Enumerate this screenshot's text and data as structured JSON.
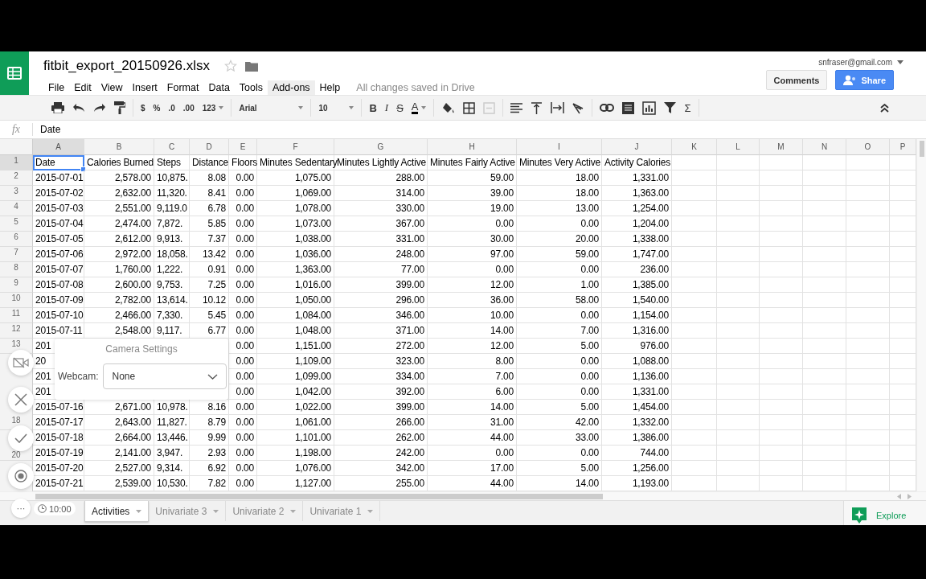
{
  "document": {
    "title": "fitbit_export_20150926.xlsx",
    "save_status": "All changes saved in Drive"
  },
  "menu": [
    {
      "label": "File",
      "highlighted": false
    },
    {
      "label": "Edit",
      "highlighted": false
    },
    {
      "label": "View",
      "highlighted": false
    },
    {
      "label": "Insert",
      "highlighted": false
    },
    {
      "label": "Format",
      "highlighted": false
    },
    {
      "label": "Data",
      "highlighted": false
    },
    {
      "label": "Tools",
      "highlighted": false
    },
    {
      "label": "Add-ons",
      "highlighted": true
    },
    {
      "label": "Help",
      "highlighted": false
    }
  ],
  "account": {
    "email": "snfraser@gmail.com"
  },
  "buttons": {
    "comments": "Comments",
    "share": "Share"
  },
  "toolbar": {
    "currency": "$",
    "percent": "%",
    "decimal_less": ".0",
    "decimal_more": ".00",
    "number_format": "123",
    "font": "Arial",
    "font_size": "10",
    "bold": "B",
    "italic": "I",
    "strike": "S",
    "text_color": "A",
    "functions": "Σ"
  },
  "formula_bar": {
    "label": "fx",
    "value": "Date"
  },
  "columns": [
    {
      "letter": "A",
      "selected": true
    },
    {
      "letter": "B",
      "selected": false
    },
    {
      "letter": "C",
      "selected": false
    },
    {
      "letter": "D",
      "selected": false
    },
    {
      "letter": "E",
      "selected": false
    },
    {
      "letter": "F",
      "selected": false
    },
    {
      "letter": "G",
      "selected": false
    },
    {
      "letter": "H",
      "selected": false
    },
    {
      "letter": "I",
      "selected": false
    },
    {
      "letter": "J",
      "selected": false
    },
    {
      "letter": "K",
      "selected": false
    },
    {
      "letter": "L",
      "selected": false
    },
    {
      "letter": "M",
      "selected": false
    },
    {
      "letter": "N",
      "selected": false
    },
    {
      "letter": "O",
      "selected": false
    },
    {
      "letter": "P",
      "selected": false
    }
  ],
  "rows": [
    {
      "number": "1",
      "selected": true,
      "cells": [
        "Date",
        "Calories Burned",
        "Steps",
        "Distance",
        "Floors",
        "Minutes Sedentary",
        "Minutes Lightly Active",
        "Minutes Fairly Active",
        "Minutes Very Active",
        "Activity Calories"
      ]
    },
    {
      "number": "2",
      "selected": false,
      "cells": [
        "2015-07-01",
        "2,578.00",
        "10,875.",
        "8.08",
        "0.00",
        "1,075.00",
        "288.00",
        "59.00",
        "18.00",
        "1,331.00"
      ]
    },
    {
      "number": "3",
      "selected": false,
      "cells": [
        "2015-07-02",
        "2,632.00",
        "11,320.",
        "8.41",
        "0.00",
        "1,069.00",
        "314.00",
        "39.00",
        "18.00",
        "1,363.00"
      ]
    },
    {
      "number": "4",
      "selected": false,
      "cells": [
        "2015-07-03",
        "2,551.00",
        "9,119.0",
        "6.78",
        "0.00",
        "1,078.00",
        "330.00",
        "19.00",
        "13.00",
        "1,254.00"
      ]
    },
    {
      "number": "5",
      "selected": false,
      "cells": [
        "2015-07-04",
        "2,474.00",
        "7,872.",
        "5.85",
        "0.00",
        "1,073.00",
        "367.00",
        "0.00",
        "0.00",
        "1,204.00"
      ]
    },
    {
      "number": "6",
      "selected": false,
      "cells": [
        "2015-07-05",
        "2,612.00",
        "9,913.",
        "7.37",
        "0.00",
        "1,038.00",
        "331.00",
        "30.00",
        "20.00",
        "1,338.00"
      ]
    },
    {
      "number": "7",
      "selected": false,
      "cells": [
        "2015-07-06",
        "2,972.00",
        "18,058.",
        "13.42",
        "0.00",
        "1,036.00",
        "248.00",
        "97.00",
        "59.00",
        "1,747.00"
      ]
    },
    {
      "number": "8",
      "selected": false,
      "cells": [
        "2015-07-07",
        "1,760.00",
        "1,222.",
        "0.91",
        "0.00",
        "1,363.00",
        "77.00",
        "0.00",
        "0.00",
        "236.00"
      ]
    },
    {
      "number": "9",
      "selected": false,
      "cells": [
        "2015-07-08",
        "2,600.00",
        "9,753.",
        "7.25",
        "0.00",
        "1,016.00",
        "399.00",
        "12.00",
        "1.00",
        "1,385.00"
      ]
    },
    {
      "number": "10",
      "selected": false,
      "cells": [
        "2015-07-09",
        "2,782.00",
        "13,614.",
        "10.12",
        "0.00",
        "1,050.00",
        "296.00",
        "36.00",
        "58.00",
        "1,540.00"
      ]
    },
    {
      "number": "11",
      "selected": false,
      "cells": [
        "2015-07-10",
        "2,466.00",
        "7,330.",
        "5.45",
        "0.00",
        "1,084.00",
        "346.00",
        "10.00",
        "0.00",
        "1,154.00"
      ]
    },
    {
      "number": "12",
      "selected": false,
      "cells": [
        "2015-07-11",
        "2,548.00",
        "9,117.",
        "6.77",
        "0.00",
        "1,048.00",
        "371.00",
        "14.00",
        "7.00",
        "1,316.00"
      ]
    },
    {
      "number": "13",
      "selected": false,
      "cells": [
        "201",
        null,
        null,
        null,
        "0.00",
        "1,151.00",
        "272.00",
        "12.00",
        "5.00",
        "976.00"
      ]
    },
    {
      "selected": false,
      "cells": [
        "20",
        null,
        null,
        null,
        "0.00",
        "1,109.00",
        "323.00",
        "8.00",
        "0.00",
        "1,088.00"
      ]
    },
    {
      "selected": false,
      "cells": [
        "201",
        null,
        null,
        null,
        "0.00",
        "1,099.00",
        "334.00",
        "7.00",
        "0.00",
        "1,136.00"
      ]
    },
    {
      "selected": false,
      "cells": [
        "201",
        null,
        null,
        null,
        "0.00",
        "1,042.00",
        "392.00",
        "6.00",
        "0.00",
        "1,331.00"
      ]
    },
    {
      "selected": false,
      "cells": [
        "2015-07-16",
        "2,671.00",
        "10,978.",
        "8.16",
        "0.00",
        "1,022.00",
        "399.00",
        "14.00",
        "5.00",
        "1,454.00"
      ]
    },
    {
      "number": "18",
      "selected": false,
      "cells": [
        "2015-07-17",
        "2,643.00",
        "11,827.",
        "8.79",
        "0.00",
        "1,061.00",
        "266.00",
        "31.00",
        "42.00",
        "1,332.00"
      ]
    },
    {
      "selected": false,
      "cells": [
        "2015-07-18",
        "2,664.00",
        "13,446.",
        "9.99",
        "0.00",
        "1,101.00",
        "262.00",
        "44.00",
        "33.00",
        "1,386.00"
      ]
    },
    {
      "number": "20",
      "selected": false,
      "cells": [
        "2015-07-19",
        "2,141.00",
        "3,947.",
        "2.93",
        "0.00",
        "1,198.00",
        "242.00",
        "0.00",
        "0.00",
        "744.00"
      ]
    },
    {
      "selected": false,
      "cells": [
        "2015-07-20",
        "2,527.00",
        "9,314.",
        "6.92",
        "0.00",
        "1,076.00",
        "342.00",
        "17.00",
        "5.00",
        "1,256.00"
      ]
    },
    {
      "selected": false,
      "cells": [
        "2015-07-21",
        "2,539.00",
        "10,530.",
        "7.82",
        "0.00",
        "1,127.00",
        "255.00",
        "44.00",
        "14.00",
        "1,193.00"
      ]
    }
  ],
  "sheet_tabs": [
    {
      "label": "Activities",
      "selected": true
    },
    {
      "label": "Univariate 3",
      "selected": false
    },
    {
      "label": "Univariate 2",
      "selected": false
    },
    {
      "label": "Univariate 1",
      "selected": false
    }
  ],
  "explore": {
    "label": "Explore"
  },
  "recorder": {
    "camera_panel": {
      "title": "Camera Settings",
      "label": "Webcam:",
      "value": "None"
    },
    "more": "···",
    "timer": "10:00"
  }
}
